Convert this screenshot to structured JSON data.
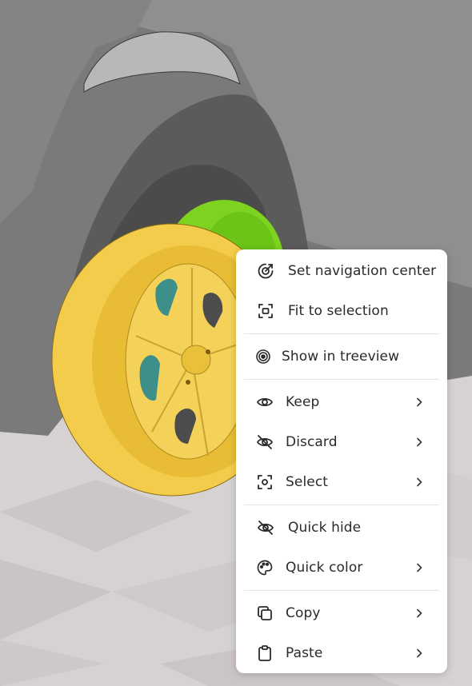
{
  "viewport": {
    "description_colors": {
      "background": "#d8d4d4",
      "car_body": "#6e6e6e",
      "tire_highlight": "#f2cc4a",
      "brake_highlight": "#7ed321"
    }
  },
  "context_menu": {
    "groups": [
      {
        "items": [
          {
            "label": "Set navigation center",
            "icon": "navigation-target-icon",
            "has_submenu": false
          },
          {
            "label": "Fit to selection",
            "icon": "fit-frame-icon",
            "has_submenu": false
          }
        ]
      },
      {
        "items": [
          {
            "label": "Show in treeview",
            "icon": "concentric-circles-icon",
            "has_submenu": false
          }
        ]
      },
      {
        "items": [
          {
            "label": "Keep",
            "icon": "eye-icon",
            "has_submenu": true
          },
          {
            "label": "Discard",
            "icon": "eye-slash-icon",
            "has_submenu": true
          },
          {
            "label": "Select",
            "icon": "select-frame-icon",
            "has_submenu": true
          }
        ]
      },
      {
        "items": [
          {
            "label": "Quick hide",
            "icon": "eye-slash-icon",
            "has_submenu": false
          },
          {
            "label": "Quick color",
            "icon": "palette-icon",
            "has_submenu": true
          }
        ]
      },
      {
        "items": [
          {
            "label": "Copy",
            "icon": "copy-icon",
            "has_submenu": true
          },
          {
            "label": "Paste",
            "icon": "clipboard-icon",
            "has_submenu": true
          }
        ]
      }
    ]
  }
}
